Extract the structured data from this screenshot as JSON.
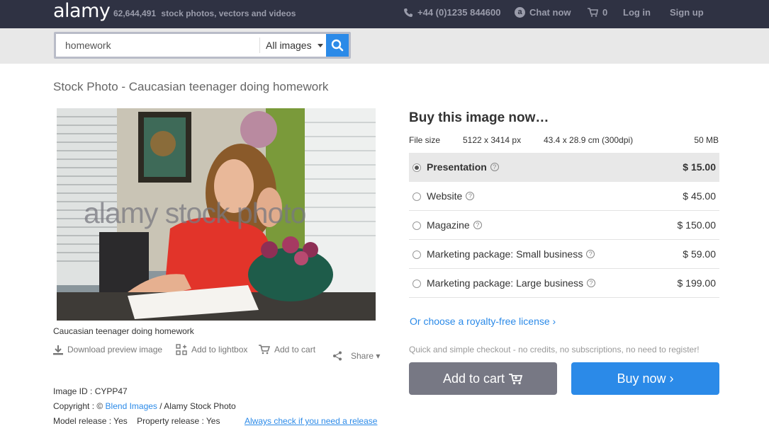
{
  "header": {
    "logo": "alamy",
    "count": "62,644,491",
    "tagline": "stock photos, vectors and videos",
    "phone": "+44 (0)1235 844600",
    "chat": "Chat now",
    "cart_count": "0",
    "login": "Log in",
    "signup": "Sign up"
  },
  "search": {
    "value": "homework",
    "category": "All images"
  },
  "page_title": "Stock Photo - Caucasian teenager doing homework",
  "image": {
    "watermark": "alamy stock photo",
    "caption": "Caucasian teenager doing homework"
  },
  "actions": {
    "download": "Download preview image",
    "lightbox": "Add to lightbox",
    "cart": "Add to cart",
    "share": "Share ▾"
  },
  "meta": {
    "image_id": "Image ID : CYPP47",
    "copyright_prefix": "Copyright : ©",
    "copyright_owner": "Blend Images",
    "copyright_suffix": "/ Alamy Stock Photo",
    "release": "Model release : Yes    Property release : Yes",
    "release_link": "Always check if you need a release"
  },
  "buy": {
    "title": "Buy this image now…",
    "file_label": "File size",
    "pixels": "5122 x 3414 px",
    "cm": "43.4 x 28.9 cm (300dpi)",
    "mb": "50 MB",
    "options": [
      {
        "name": "Presentation",
        "price": "$ 15.00"
      },
      {
        "name": "Website",
        "price": "$ 45.00"
      },
      {
        "name": "Magazine",
        "price": "$ 150.00"
      },
      {
        "name": "Marketing package: Small business",
        "price": "$ 59.00"
      },
      {
        "name": "Marketing package: Large business",
        "price": "$ 199.00"
      }
    ],
    "royalty_link": "Or choose a royalty-free license ›",
    "quick_text": "Quick and simple checkout - no credits, no subscriptions, no need to register!",
    "add_to_cart": "Add to cart",
    "buy_now": "Buy now ›"
  },
  "colors": {
    "topbar": "#2f3243",
    "accent": "#2b8ae8",
    "cart_button": "#777884"
  }
}
